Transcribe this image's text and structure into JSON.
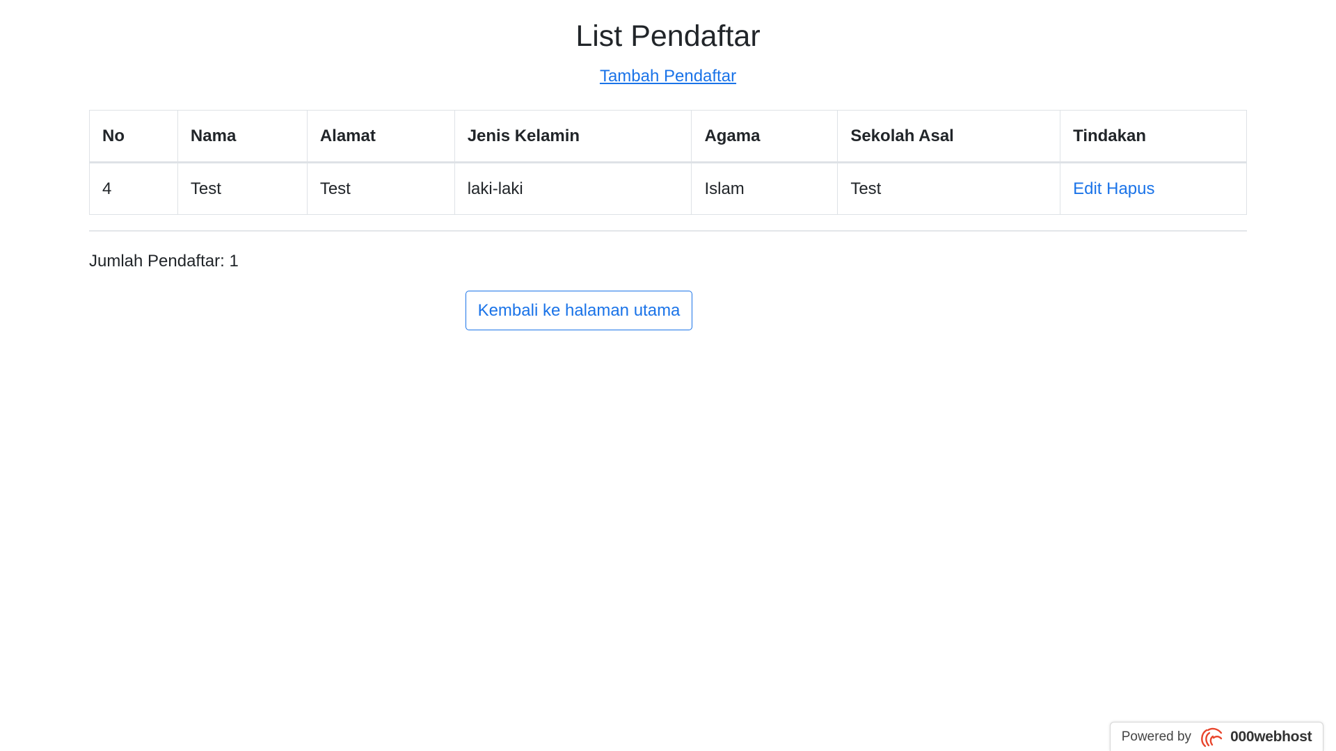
{
  "page": {
    "title": "List Pendaftar",
    "add_link": "Tambah Pendaftar"
  },
  "table": {
    "headers": [
      "No",
      "Nama",
      "Alamat",
      "Jenis Kelamin",
      "Agama",
      "Sekolah Asal",
      "Tindakan"
    ],
    "rows": [
      {
        "no": "4",
        "nama": "Test",
        "alamat": "Test",
        "jenis_kelamin": "laki-laki",
        "agama": "Islam",
        "sekolah_asal": "Test",
        "edit_label": "Edit",
        "hapus_label": "Hapus"
      }
    ]
  },
  "summary": {
    "count_text": "Jumlah Pendaftar: 1"
  },
  "back_button": {
    "label": "Kembali ke halaman utama"
  },
  "footer_badge": {
    "powered": "Powered by",
    "brand": "000webhost",
    "logo_icon": "000webhost-logo-icon"
  },
  "colors": {
    "link": "#1a73e8",
    "text": "#212529",
    "border": "#dee2e6",
    "logo": "#e8452c"
  }
}
